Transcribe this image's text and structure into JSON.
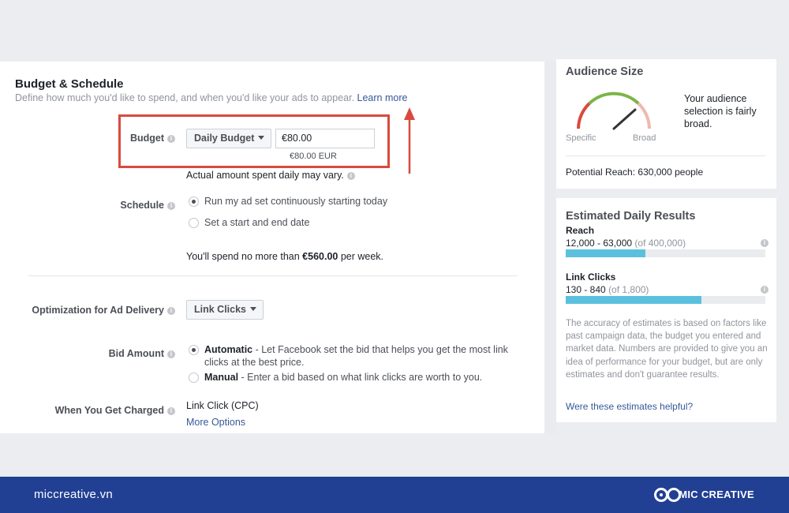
{
  "budget_schedule": {
    "title": "Budget & Schedule",
    "description": "Define how much you'd like to spend, and when you'd like your ads to appear.",
    "learn_more": "Learn more",
    "budget_label": "Budget",
    "budget_type": "Daily Budget",
    "budget_value": "€80.00",
    "budget_note": "€80.00 EUR",
    "actual_note": "Actual amount spent daily may vary.",
    "schedule_label": "Schedule",
    "schedule_options": [
      "Run my ad set continuously starting today",
      "Set a start and end date"
    ],
    "spend_prefix": "You'll spend no more than ",
    "spend_amount": "€560.00",
    "spend_suffix": " per week.",
    "optimization_label": "Optimization for Ad Delivery",
    "optimization_value": "Link Clicks",
    "bid_label": "Bid Amount",
    "bid_automatic_bold": "Automatic",
    "bid_automatic_text": " - Let Facebook set the bid that helps you get the most link clicks at the best price.",
    "bid_manual_bold": "Manual",
    "bid_manual_text": " - Enter a bid based on what link clicks are worth to you.",
    "charged_label": "When You Get Charged",
    "charged_value": "Link Click (CPC)",
    "more_options": "More Options"
  },
  "audience": {
    "title": "Audience Size",
    "description": "Your audience selection is fairly broad.",
    "gauge_specific": "Specific",
    "gauge_broad": "Broad",
    "gauge_level": 0.7,
    "potential_reach": "Potential Reach: 630,000 people"
  },
  "estimates": {
    "title": "Estimated Daily Results",
    "reach_label": "Reach",
    "reach_value": "12,000 - 63,000",
    "reach_total": "(of 400,000)",
    "reach_fraction": 0.4,
    "clicks_label": "Link Clicks",
    "clicks_value": "130 - 840",
    "clicks_total": "(of 1,800)",
    "clicks_fraction": 0.68,
    "disclaimer": "The accuracy of estimates is based on factors like past campaign data, the budget you entered and market data. Numbers are provided to give you an idea of performance for your budget, but are only estimates and don't guarantee results.",
    "helpful_link": "Were these estimates helpful?"
  },
  "footer": {
    "website": "miccreative.vn",
    "brand": "MIC CREATIVE"
  },
  "colors": {
    "highlight": "#d94a3d",
    "link": "#365899",
    "bar": "#5bc0de",
    "footer": "#213f93"
  }
}
